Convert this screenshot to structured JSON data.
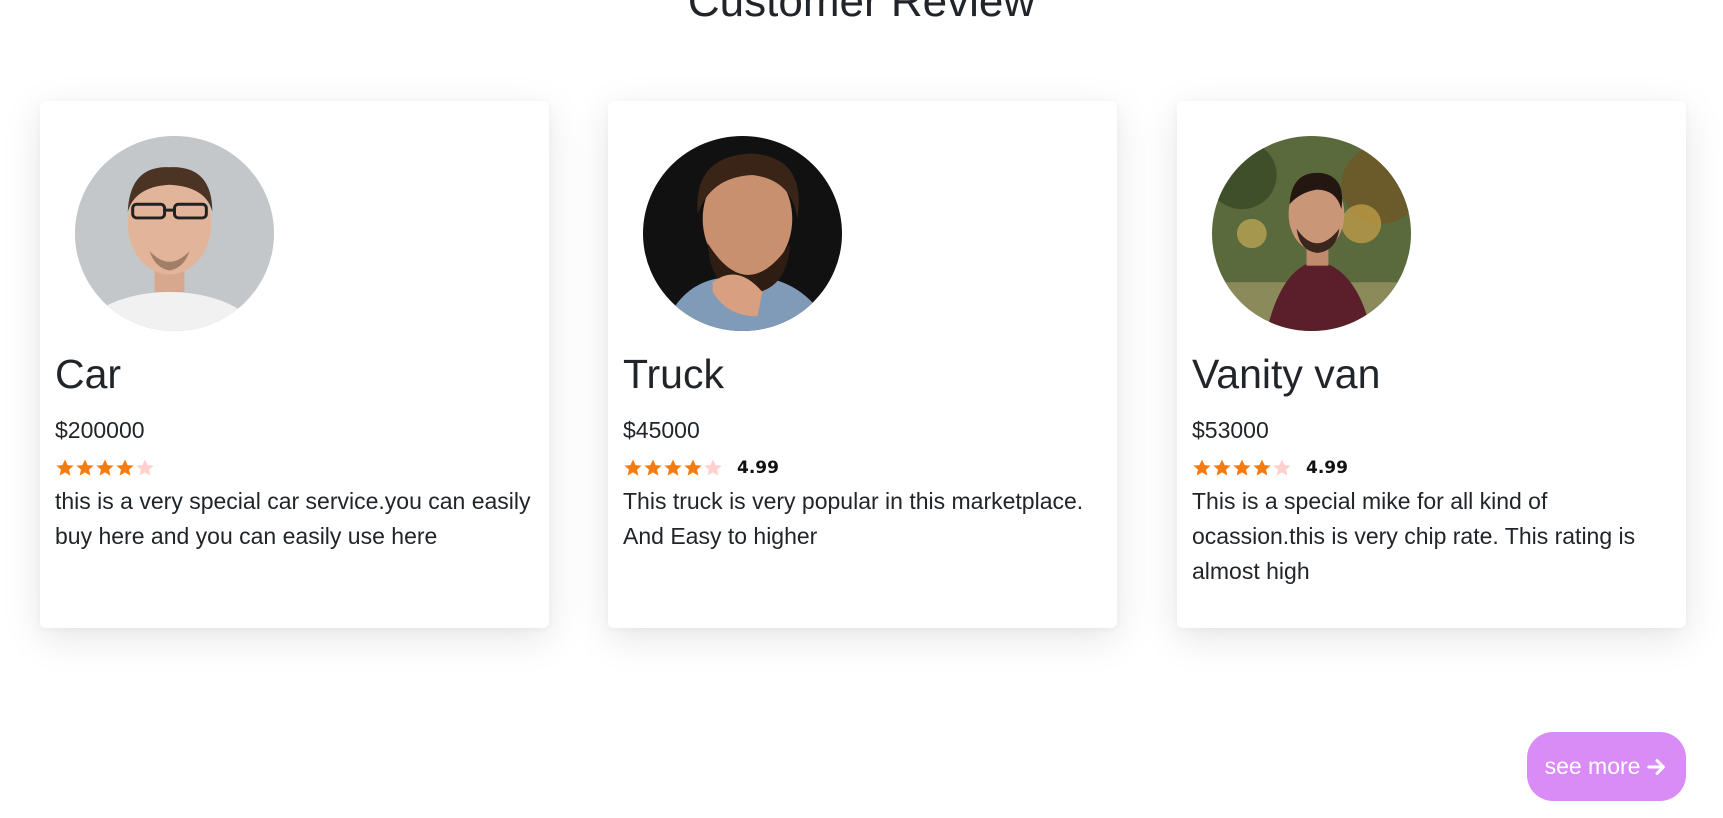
{
  "section": {
    "title": "Customer Review"
  },
  "cards": [
    {
      "name": "Car",
      "price": "$200000",
      "rating": 4,
      "rating_value": "",
      "description": "this is a very special car service.you can easily buy here and you can easily use here",
      "avatar": "person-avatar"
    },
    {
      "name": "Truck",
      "price": "$45000",
      "rating": 4,
      "rating_value": "4.99",
      "description": "This truck is very popular in this marketplace. And Easy to higher",
      "avatar": "person-avatar"
    },
    {
      "name": "Vanity van",
      "price": "$53000",
      "rating": 4,
      "rating_value": "4.99",
      "description": "This is a special mike for all kind of ocassion.this is very chip rate. This rating is almost high",
      "avatar": "person-avatar"
    }
  ],
  "see_more": {
    "label": "see more",
    "icon": "arrow-right-icon"
  },
  "colors": {
    "star_filled": "#f47c13",
    "star_empty": "#ffd0cc",
    "button_bg": "#d98cf5",
    "text": "#212529"
  }
}
